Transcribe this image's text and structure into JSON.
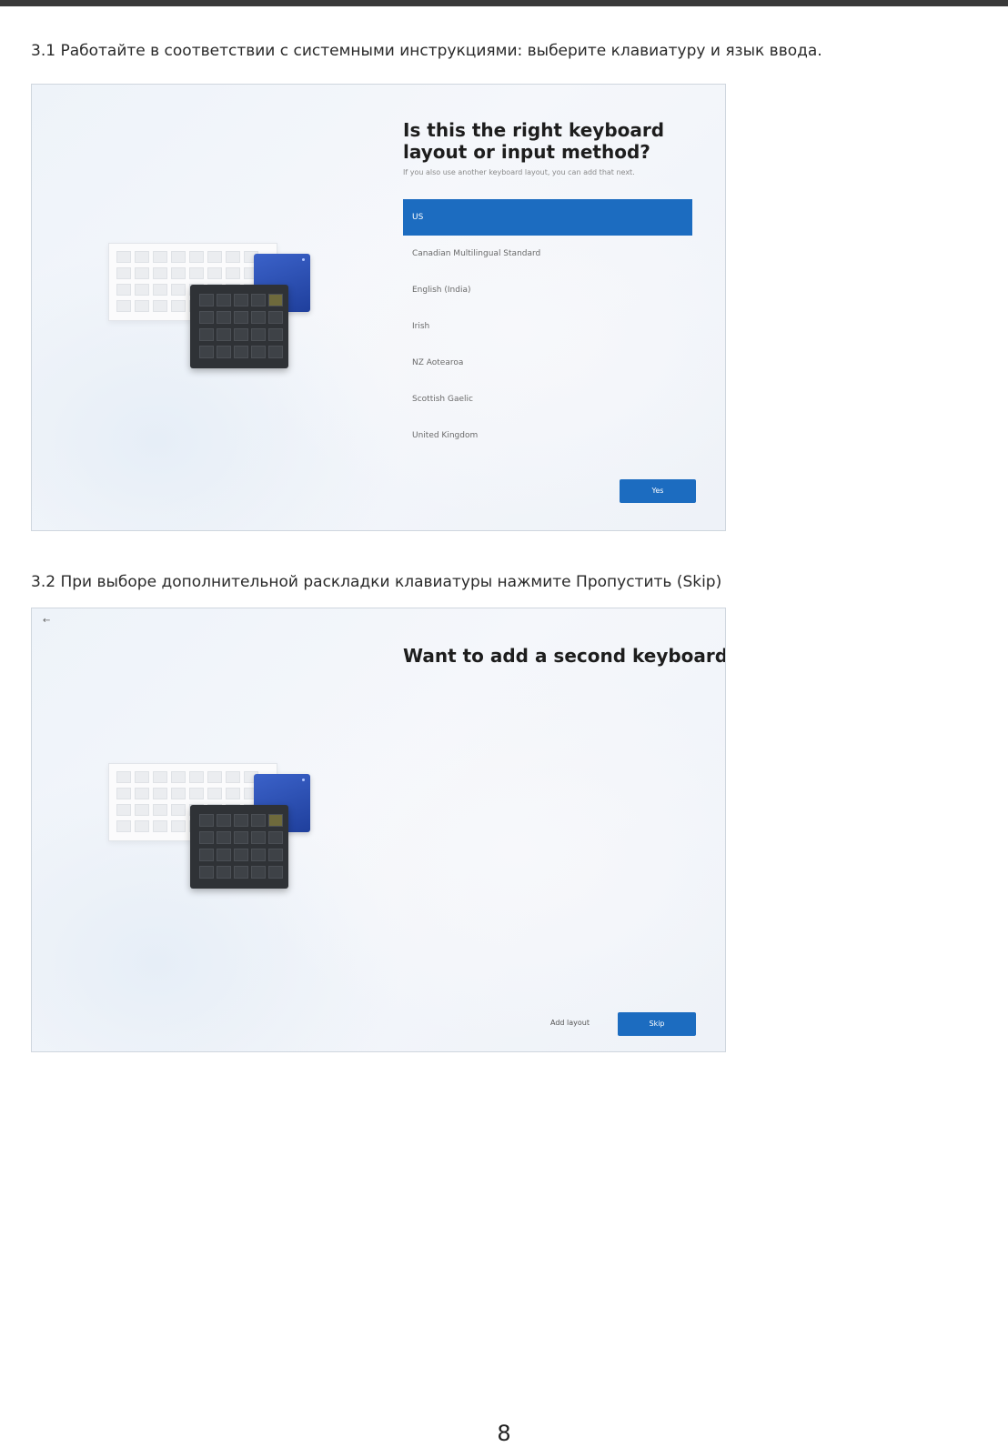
{
  "step1": {
    "caption": "3.1 Работайте в соответствии с системными инструкциями: выберите клавиатуру и язык ввода.",
    "screen": {
      "title": "Is this the right keyboard layout or input method?",
      "subtitle": "If you also use another keyboard layout, you can add that next.",
      "options": [
        {
          "label": "US",
          "selected": true
        },
        {
          "label": "Canadian Multilingual Standard",
          "selected": false
        },
        {
          "label": "English (India)",
          "selected": false
        },
        {
          "label": "Irish",
          "selected": false
        },
        {
          "label": "NZ Aotearoa",
          "selected": false
        },
        {
          "label": "Scottish Gaelic",
          "selected": false
        },
        {
          "label": "United Kingdom",
          "selected": false
        }
      ],
      "yes_button": "Yes"
    }
  },
  "step2": {
    "caption": "3.2 При выборе дополнительной раскладки клавиатуры  нажмите  Пропустить  (Skip)",
    "screen": {
      "back_icon": "←",
      "title": "Want to add a second keyboard layout?",
      "add_layout_link": "Add layout",
      "skip_button": "Skip"
    }
  },
  "page_number": "8",
  "colors": {
    "accent": "#1c6cc0",
    "dark_keyboard": "#2f3236",
    "blue_card": "#2c4fb3"
  }
}
